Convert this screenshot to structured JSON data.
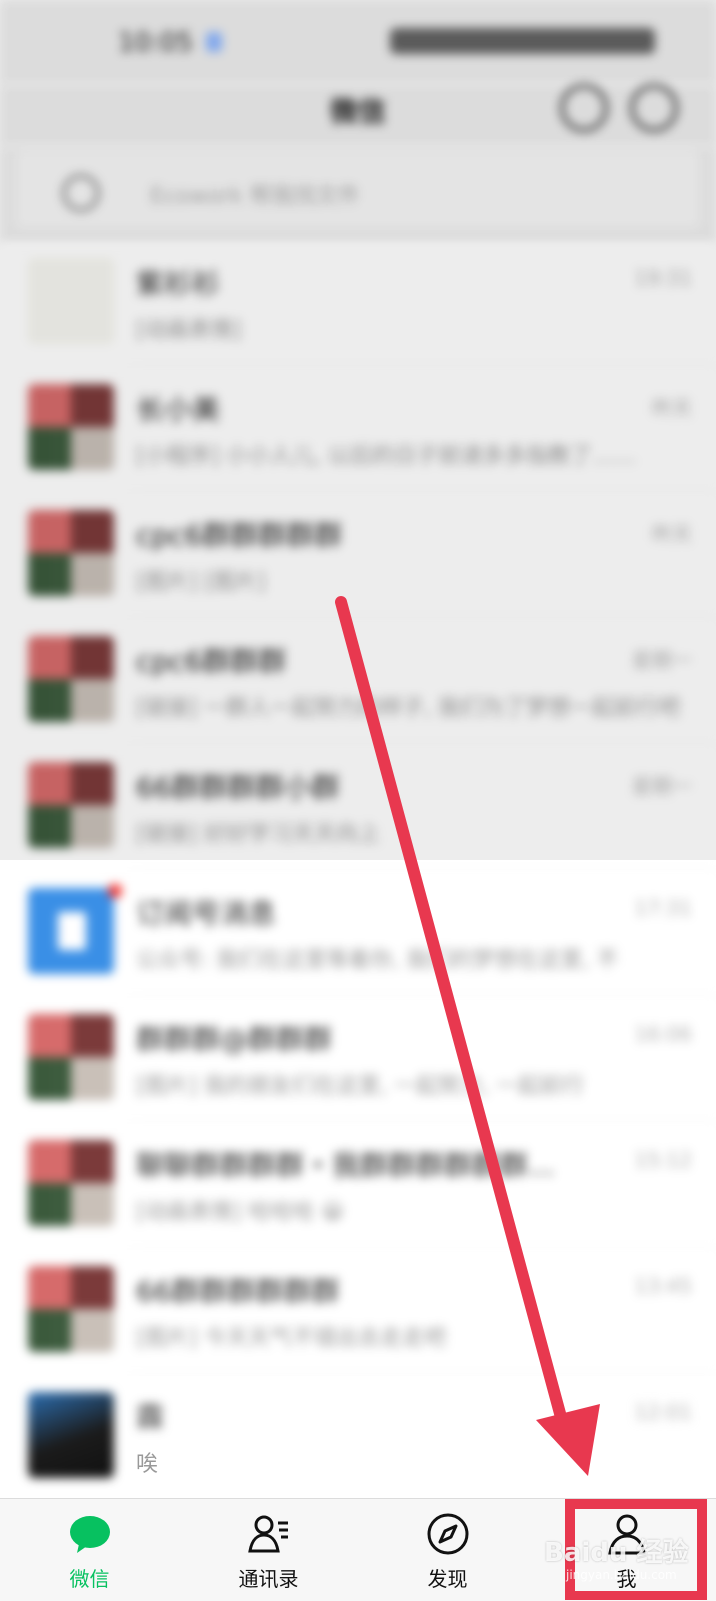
{
  "status_bar": {
    "time": "10:05"
  },
  "nav": {
    "title": "微信"
  },
  "search": {
    "placeholder": "Ecowork 帮我找文件"
  },
  "chats": [
    {
      "name": "紫衫衫",
      "preview": "[动画表情]",
      "time": "19:31",
      "avatar": "light",
      "badge": false
    },
    {
      "name": "长小美",
      "preview": "[小程序] 小小人儿, 以后的日子就请多多指教了……",
      "time": "昨天",
      "avatar": "mosaic",
      "badge": false
    },
    {
      "name": "cpc6群群群群群",
      "preview": "[图片] [图片]",
      "time": "昨天",
      "avatar": "mosaic",
      "badge": false
    },
    {
      "name": "cpc6群群群",
      "preview": "[链接] 一群人一起努力的样子, 我们为了梦想一起前行吧",
      "time": "星期一",
      "avatar": "mosaic",
      "badge": false
    },
    {
      "name": "66群群群群小群",
      "preview": "[链接] 好好学习天天向上",
      "time": "星期一",
      "avatar": "mosaic",
      "badge": false
    },
    {
      "name": "订阅号消息",
      "preview": "公众号: 我们在这里等着你, 我们的梦想在这里, 不",
      "time": "17:31",
      "avatar": "app",
      "badge": true
    },
    {
      "name": "群群群@群群群",
      "preview": "[图片] 我的朋友们在这里, 一起努力, 一起前行",
      "time": "16:06",
      "avatar": "mosaic",
      "badge": false
    },
    {
      "name": "聊聊群群群群・我群群群群群群...",
      "preview": "[动画表情] 哈哈哈 😀",
      "time": "15:12",
      "avatar": "mosaic",
      "badge": false
    },
    {
      "name": "66群群群群群群",
      "preview": "[图片] 今天天气不错出去走走吧",
      "time": "13:45",
      "avatar": "mosaic",
      "badge": false
    },
    {
      "name": "霖",
      "preview": "唉",
      "time": "12:01",
      "avatar": "dark",
      "badge": false
    }
  ],
  "tabs": [
    {
      "label": "微信",
      "icon": "chat-bubble-icon",
      "active": true
    },
    {
      "label": "通讯录",
      "icon": "contacts-icon",
      "active": false
    },
    {
      "label": "发现",
      "icon": "compass-icon",
      "active": false
    },
    {
      "label": "我",
      "icon": "person-icon",
      "active": false
    }
  ],
  "annotation": {
    "arrow_color": "#e8384f",
    "box_color": "#e8384f"
  },
  "watermark": {
    "text": "Baidu 经验",
    "sub": "jingyan.baidu.com"
  }
}
